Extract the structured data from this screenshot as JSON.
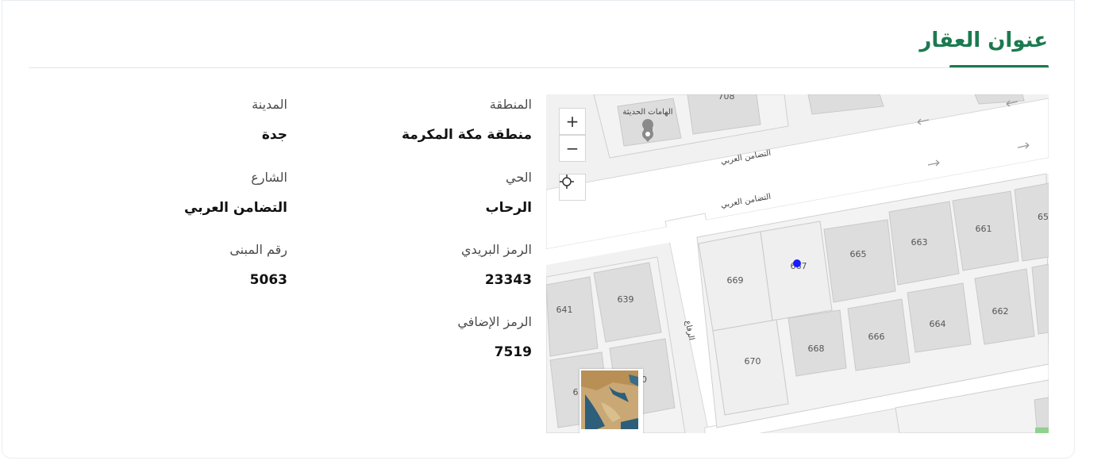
{
  "section": {
    "title": "عنوان العقار"
  },
  "fields": {
    "region": {
      "label": "المنطقة",
      "value": "منطقة مكة المكرمة"
    },
    "city": {
      "label": "المدينة",
      "value": "جدة"
    },
    "district": {
      "label": "الحي",
      "value": "الرحاب"
    },
    "street": {
      "label": "الشارع",
      "value": "التضامن العربي"
    },
    "postal_code": {
      "label": "الرمز البريدي",
      "value": "23343"
    },
    "building_number": {
      "label": "رقم المبنى",
      "value": "5063"
    },
    "additional_code": {
      "label": "الرمز الإضافي",
      "value": "7519"
    }
  },
  "map": {
    "zoom_in_label": "+",
    "zoom_out_label": "−",
    "poi_name": "الهامات الحديثة",
    "street_names": [
      "التضامن العربي",
      "التضامن العربي",
      "الرفاع"
    ],
    "parcels": [
      "708",
      "669",
      "667",
      "665",
      "663",
      "661",
      "65",
      "639",
      "641",
      "670",
      "668",
      "666",
      "664",
      "662",
      "6",
      "40"
    ],
    "marker_color": "#1a1aff"
  },
  "colors": {
    "accent": "#1b7a4f"
  }
}
